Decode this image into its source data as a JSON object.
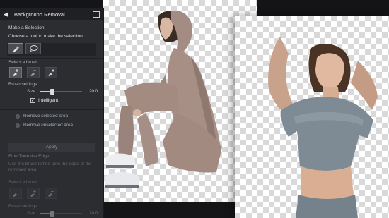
{
  "panel": {
    "title": "Background Removal",
    "make_selection": "Make a Selection",
    "choose_tool": "Choose a tool to make the selection:",
    "select_brush": "Select a brush:",
    "brush_settings": "Brush settings:",
    "size_label": "Size",
    "size_value": "20.0",
    "size_level": 0.3,
    "intelligent_label": "Intelligent",
    "intelligent_checked": true,
    "remove_selected": "Remove selected area",
    "remove_unselected": "Remove unselected area",
    "apply_label": "Apply"
  },
  "fine_tune": {
    "title": "Fine Tune the Edge",
    "description": "Use the brush to fine tune the edge of the removed area.",
    "select_brush": "Select a brush:",
    "brush_settings": "Brush settings:",
    "size_label": "Size",
    "size_value": "20.0"
  },
  "icons": {
    "back": "back-arrow-icon",
    "options": "panel-options-icon",
    "brush_tool": "smart-brush-icon",
    "lasso_tool": "lasso-icon",
    "add_brush": "add-brush-icon",
    "erase_brush": "erase-brush-icon",
    "smart_brush": "smart-select-brush-icon"
  },
  "colors": {
    "panel_bg": "#2b2d31",
    "titlebar_bg": "#1f2023",
    "hoodie": "#a78f86",
    "top": "#7f8b94"
  }
}
